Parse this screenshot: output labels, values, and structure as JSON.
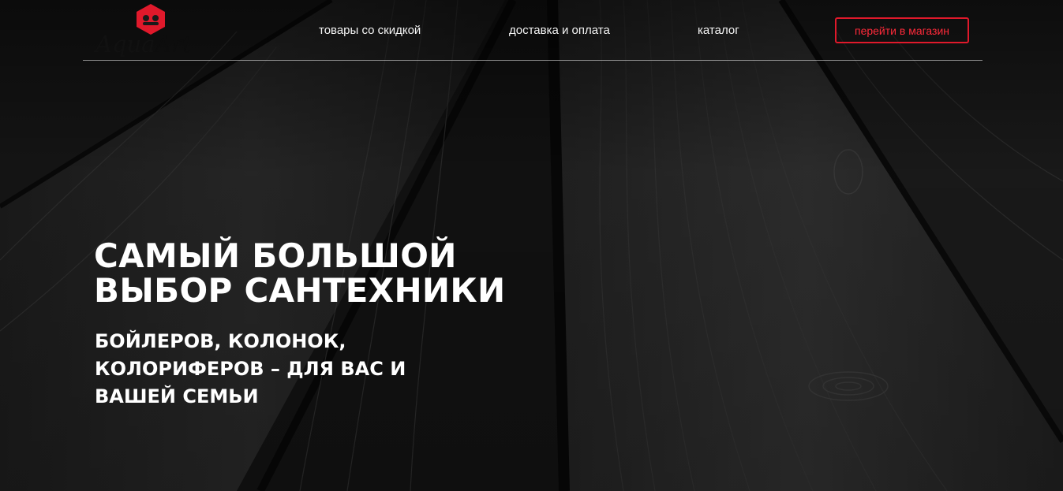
{
  "brand": {
    "logo_part1": "Aqua",
    "logo_part2": "Art",
    "logo_color": "#e0192b"
  },
  "nav": {
    "items": [
      {
        "label": "товары со скидкой"
      },
      {
        "label": "доставка и оплата"
      },
      {
        "label": "каталог"
      }
    ],
    "cta_label": "перейти в магазин"
  },
  "hero": {
    "headline_line1": "САМЫЙ БОЛЬШОЙ",
    "headline_line2": "ВЫБОР САНТЕХНИКИ",
    "subhead_line1": "БОЙЛЕРОВ, КОЛОНОК,",
    "subhead_line2": "КОЛОРИФЕРОВ – ДЛЯ ВАС И",
    "subhead_line3": "ВАШЕЙ СЕМЬИ"
  },
  "colors": {
    "accent": "#e0192b",
    "text": "#ffffff",
    "background": "#1a1a1a"
  }
}
